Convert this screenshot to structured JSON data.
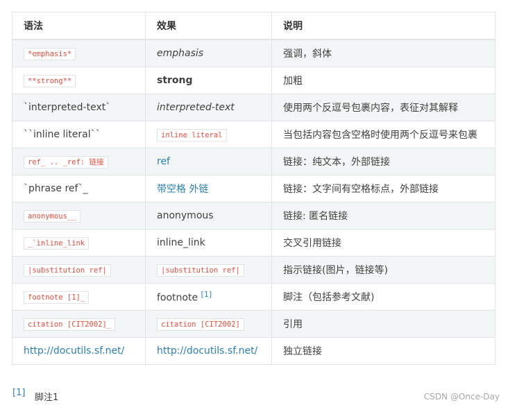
{
  "table": {
    "headers": [
      "语法",
      "效果",
      "说明"
    ],
    "rows": [
      {
        "syntax": "*emphasis*",
        "effect": "emphasis",
        "desc": "强调，斜体"
      },
      {
        "syntax": "**strong**",
        "effect": "strong",
        "desc": "加粗"
      },
      {
        "syntax": "`interpreted-text`",
        "effect": "interpreted-text",
        "desc": "使用两个反逗号包裹内容，表征对其解释"
      },
      {
        "syntax": "``inline literal``",
        "effect": "inline literal",
        "desc": "当包括内容包含空格时使用两个反逗号来包裹"
      },
      {
        "syntax": "ref_  .. _ref: 链接",
        "effect": "ref",
        "desc": "链接：纯文本，外部链接"
      },
      {
        "syntax": "`phrase ref`_",
        "effect": "带空格 外链",
        "desc": "链接：文字间有空格标点，外部链接"
      },
      {
        "syntax": "anonymous__",
        "effect": "anonymous",
        "desc": "链接: 匿名链接"
      },
      {
        "syntax": "_`inline_link",
        "effect": "inline_link",
        "desc": "交叉引用链接"
      },
      {
        "syntax": "|substitution ref|",
        "effect": "|substitution ref|",
        "desc": "指示链接(图片，链接等)"
      },
      {
        "syntax": "footnote [1]_",
        "effect": "footnote",
        "effect_sup": "[1]",
        "desc": "脚注（包括参考文献)"
      },
      {
        "syntax": "citation [CIT2002]_",
        "effect": "citation [CIT2002]",
        "desc": "引用"
      },
      {
        "syntax": "http://docutils.sf.net/",
        "effect": "http://docutils.sf.net/",
        "desc": "独立链接"
      }
    ]
  },
  "footnote": {
    "label": "[1]",
    "text": "脚注1"
  },
  "watermark": "CSDN @Once-Day",
  "colors": {
    "accent": "#2980b9",
    "code": "#e74c3c",
    "stripe": "#f3f6f6",
    "border": "#e1e4e5"
  }
}
